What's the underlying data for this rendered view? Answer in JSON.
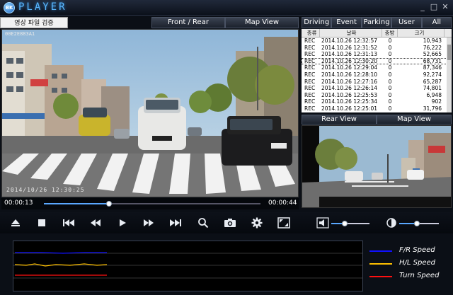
{
  "app": {
    "title": "PLAYER",
    "logo_text": "BK"
  },
  "window_controls": {
    "min": "_",
    "max": "□",
    "close": "✕"
  },
  "file_verify_label": "영상 파일 검증",
  "front_view": {
    "front_rear_label": "Front / Rear",
    "map_label": "Map View",
    "camera_id": "00E2E883A1",
    "osd_timestamp": "2014/10/26 12:30:25"
  },
  "playback": {
    "current_time": "00:00:13",
    "total_time": "00:00:44",
    "progress": 0.3
  },
  "tabs": [
    "Driving",
    "Event",
    "Parking",
    "User",
    "All"
  ],
  "record_list": {
    "columns": [
      "종류",
      "날짜",
      "충방",
      "크기"
    ],
    "rows": [
      [
        "REC",
        "2014.10.26 12:32:57",
        "0",
        "10,943"
      ],
      [
        "REC",
        "2014.10.26 12:31:52",
        "0",
        "76,222"
      ],
      [
        "REC",
        "2014.10.26 12:31:13",
        "0",
        "52,665"
      ],
      [
        "REC",
        "2014.10.26 12:30:20",
        "0",
        "68,731"
      ],
      [
        "REC",
        "2014.10.26 12:29:04",
        "0",
        "87,346"
      ],
      [
        "REC",
        "2014.10.26 12:28:10",
        "0",
        "92,274"
      ],
      [
        "REC",
        "2014.10.26 12:27:16",
        "0",
        "65,287"
      ],
      [
        "REC",
        "2014.10.26 12:26:14",
        "0",
        "74,801"
      ],
      [
        "REC",
        "2014.10.26 12:25:53",
        "0",
        "6,948"
      ],
      [
        "REC",
        "2014.10.26 12:25:34",
        "0",
        "902"
      ],
      [
        "REC",
        "2014.10.26 12:25:01",
        "0",
        "31,796"
      ]
    ],
    "selected_index": 3
  },
  "rear_view": {
    "rear_label": "Rear View",
    "map_label": "Map View"
  },
  "controls": {
    "icons": [
      "eject-icon",
      "stop-icon",
      "skip-back-icon",
      "rewind-icon",
      "play-icon",
      "fast-forward-icon",
      "skip-forward-icon",
      "zoom-icon",
      "camera-icon",
      "settings-icon",
      "fullscreen-icon"
    ],
    "volume_level": 0.35,
    "brightness_level": 0.45
  },
  "legend": [
    {
      "label": "F/R Speed",
      "color": "#1010ff"
    },
    {
      "label": "H/L Speed",
      "color": "#ffc000"
    },
    {
      "label": "Turn Speed",
      "color": "#ff1010"
    }
  ]
}
